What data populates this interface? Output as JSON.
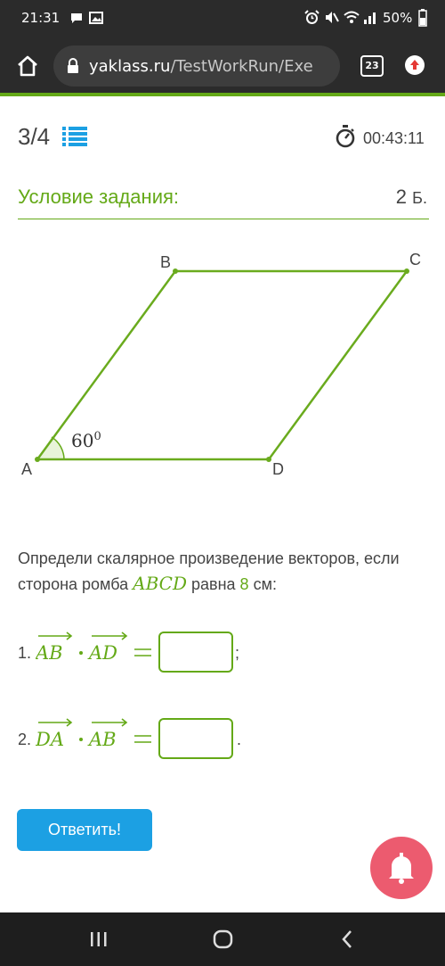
{
  "status_bar": {
    "time": "21:31",
    "battery": "50%"
  },
  "browser": {
    "url_domain": "yaklass.ru",
    "url_path": "/TestWorkRun/Exe",
    "tabs_count": "23"
  },
  "test": {
    "progress": "3/4",
    "timer": "00:43:11",
    "condition_title": "Условие задания:",
    "points_value": "2",
    "points_unit": "Б."
  },
  "figure": {
    "label_a": "A",
    "label_b": "B",
    "label_c": "C",
    "label_d": "D",
    "angle_label": "60",
    "angle_exp": "0"
  },
  "task": {
    "text_before": "Определи скалярное произведение векторов, если сторона ромба ",
    "math_name": "ABCD",
    "text_mid": " равна ",
    "side_value": "8",
    "text_after": " см:",
    "q1_number": "1.",
    "q1_vec1": "AB",
    "q1_vec2": "AD",
    "q1_tail": ";",
    "q2_number": "2.",
    "q2_vec1": "DA",
    "q2_vec2": "AB",
    "q2_tail": "."
  },
  "buttons": {
    "answer": "Ответить!"
  },
  "colors": {
    "accent_green": "#64a917",
    "button_blue": "#1ca0e3",
    "bell_red": "#ec5b6f"
  }
}
